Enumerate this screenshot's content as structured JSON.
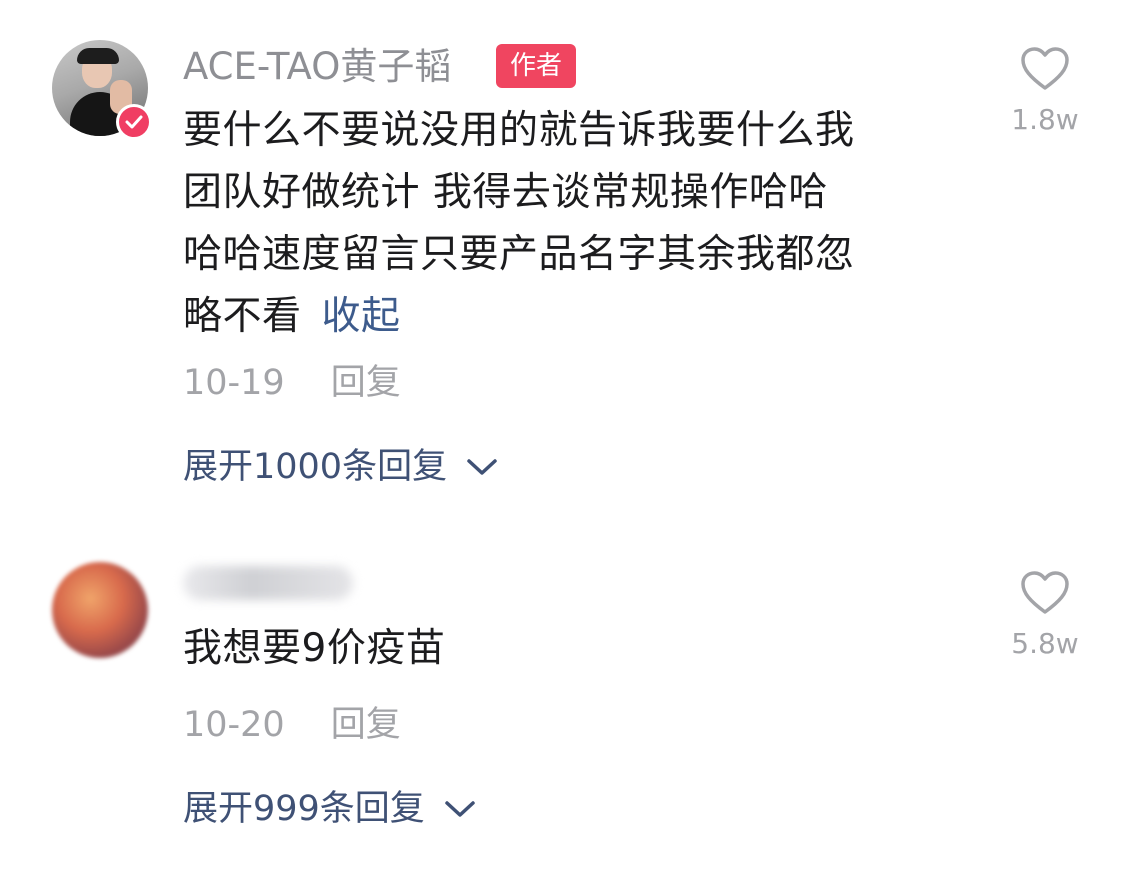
{
  "comments": [
    {
      "username": "ACE-TAO黄子韬",
      "author_tag": "作者",
      "text_lines": [
        "要什么不要说没用的就告诉我要什么我",
        "团队好做统计 我得去谈常规操作哈哈",
        "哈哈速度留言只要产品名字其余我都忽",
        "略不看"
      ],
      "collapse_label": "收起",
      "date": "10-19",
      "reply_label": "回复",
      "expand_label": "展开1000条回复",
      "likes": "1.8w"
    },
    {
      "username": "",
      "text": "我想要9价疫苗",
      "date": "10-20",
      "reply_label": "回复",
      "expand_label": "展开999条回复",
      "likes": "5.8w"
    }
  ],
  "colors": {
    "author_tag": "#f04560",
    "link": "#3d5b8c",
    "expand": "#3f5175",
    "muted": "#a3a4a8",
    "text": "#1c1c1e"
  },
  "icons": {
    "like": "heart-outline-icon",
    "expand": "chevron-down-icon",
    "verified": "check-badge-icon"
  }
}
